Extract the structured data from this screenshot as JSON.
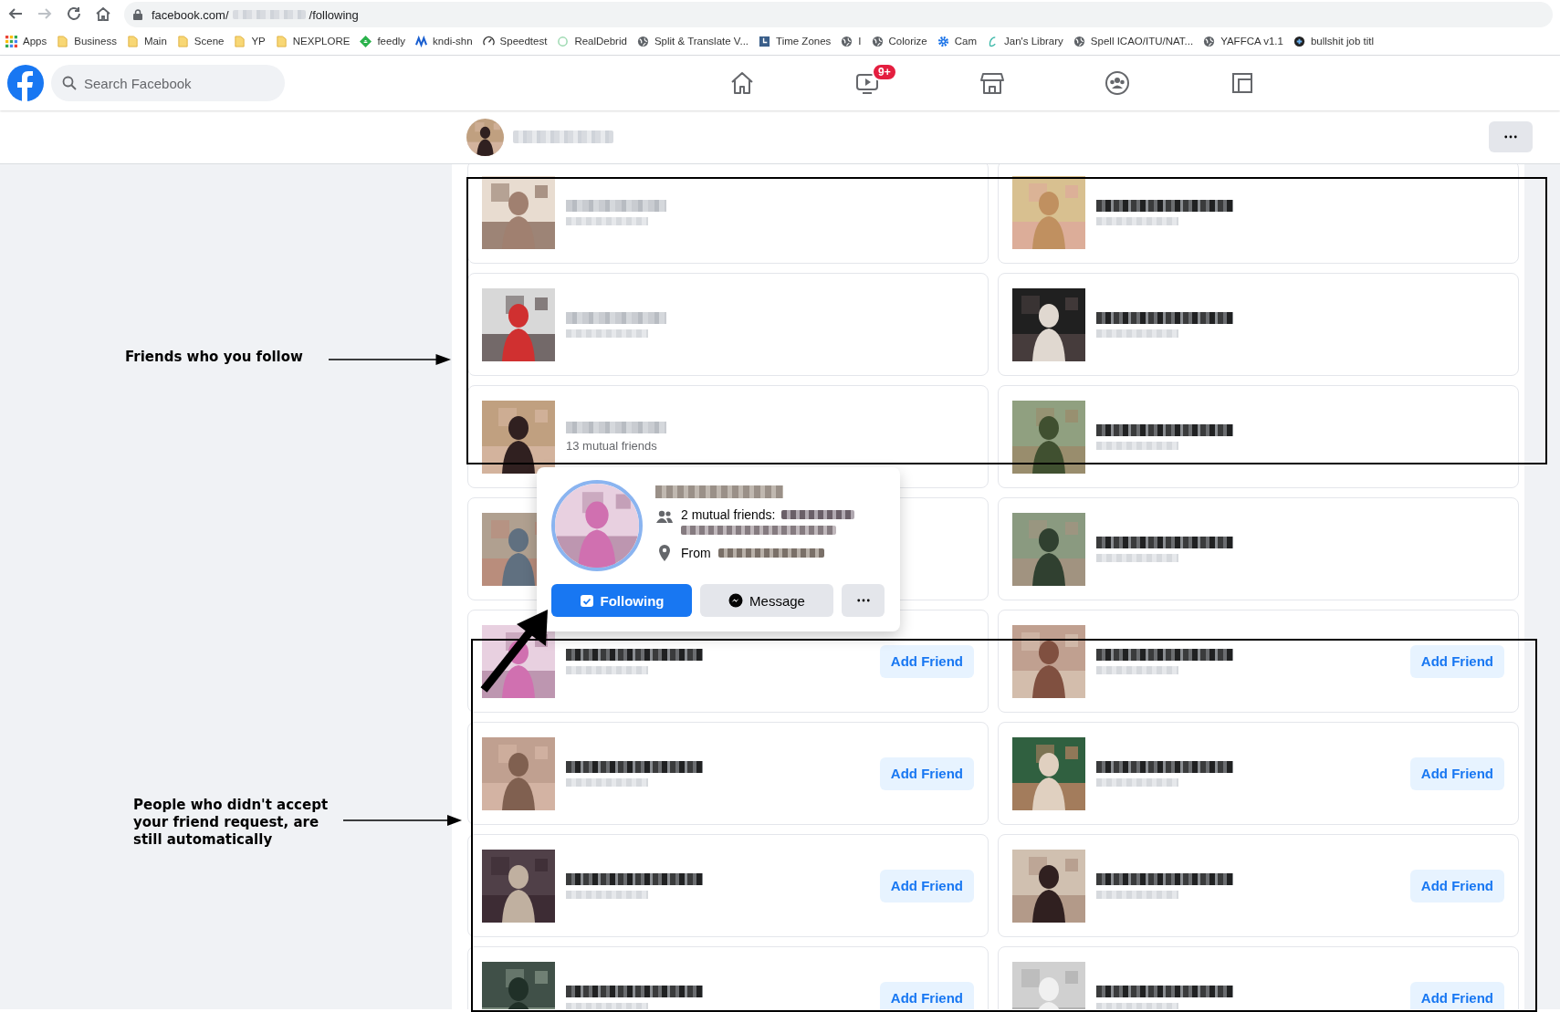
{
  "browser": {
    "address_prefix": "facebook.com/",
    "address_suffix": "/following",
    "bookmarks": [
      {
        "label": "Apps",
        "kind": "apps"
      },
      {
        "label": "Business",
        "kind": "folder"
      },
      {
        "label": "Main",
        "kind": "folder"
      },
      {
        "label": "Scene",
        "kind": "folder"
      },
      {
        "label": "YP",
        "kind": "folder"
      },
      {
        "label": "NEXPLORE",
        "kind": "folder"
      },
      {
        "label": "feedly",
        "kind": "feedly"
      },
      {
        "label": "kndi-shn",
        "kind": "wave"
      },
      {
        "label": "Speedtest",
        "kind": "gauge"
      },
      {
        "label": "RealDebrid",
        "kind": "ring"
      },
      {
        "label": "Split & Translate V...",
        "kind": "globe"
      },
      {
        "label": "Time Zones",
        "kind": "clock"
      },
      {
        "label": "I",
        "kind": "globe"
      },
      {
        "label": "Colorize",
        "kind": "globe"
      },
      {
        "label": "Cam",
        "kind": "gear"
      },
      {
        "label": "Jan's Library",
        "kind": "script"
      },
      {
        "label": "Spell ICAO/ITU/NAT...",
        "kind": "globe"
      },
      {
        "label": "YAFFCA v1.1",
        "kind": "globe"
      },
      {
        "label": "bullshit job titl",
        "kind": "badge"
      }
    ]
  },
  "header": {
    "search": {
      "placeholder": "Search Facebook"
    },
    "nav": [
      {
        "kind": "home"
      },
      {
        "kind": "video",
        "badge": "9+"
      },
      {
        "kind": "shop"
      },
      {
        "kind": "groups"
      },
      {
        "kind": "gaming"
      }
    ]
  },
  "cards": [
    {
      "kind": "named",
      "dark": false
    },
    {
      "kind": "named",
      "dark": true
    },
    {
      "kind": "named",
      "dark": false
    },
    {
      "kind": "named",
      "dark": true
    },
    {
      "kind": "named",
      "dark": false,
      "mutual": "13 mutual friends"
    },
    {
      "kind": "named",
      "dark": true
    },
    {
      "kind": "covered"
    },
    {
      "kind": "named",
      "dark": true
    },
    {
      "kind": "named",
      "dark": true,
      "button": "Add Friend"
    },
    {
      "kind": "named",
      "dark": true,
      "button": "Add Friend"
    },
    {
      "kind": "named",
      "dark": true,
      "button": "Add Friend"
    },
    {
      "kind": "named",
      "dark": true,
      "button": "Add Friend"
    },
    {
      "kind": "named",
      "dark": true,
      "button": "Add Friend"
    },
    {
      "kind": "named",
      "dark": true,
      "button": "Add Friend"
    },
    {
      "kind": "named",
      "dark": true,
      "button": "Add Friend"
    },
    {
      "kind": "named",
      "dark": true,
      "button": "Add Friend"
    }
  ],
  "hover_card": {
    "mutual_label": "2 mutual friends:",
    "from_label": "From",
    "buttons": [
      {
        "kind": "primary",
        "label": "Following"
      },
      {
        "kind": "secondary",
        "label": "Message"
      },
      {
        "kind": "more"
      }
    ]
  },
  "annotations": [
    {
      "text": "Friends who you follow"
    },
    {
      "text": "People who didn't accept your friend request, are still automatically"
    }
  ]
}
